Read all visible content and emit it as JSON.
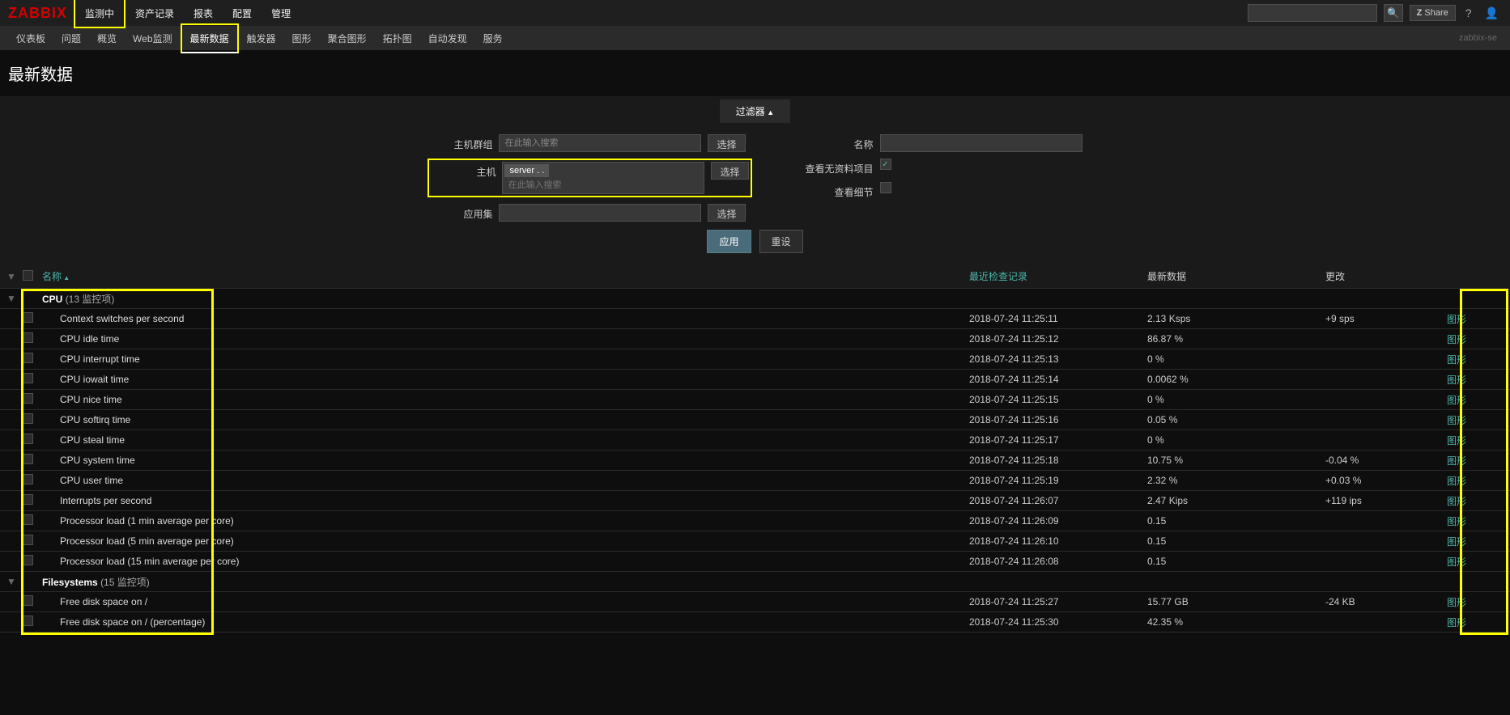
{
  "brand": "ZABBIX",
  "topnav": [
    "监测中",
    "资产记录",
    "报表",
    "配置",
    "管理"
  ],
  "share_label": "Share",
  "subnav": [
    "仪表板",
    "问题",
    "概览",
    "Web监测",
    "最新数据",
    "触发器",
    "图形",
    "聚合图形",
    "拓扑图",
    "自动发现",
    "服务"
  ],
  "server_label": "zabbix-se",
  "page_title": "最新数据",
  "filter": {
    "tab_label": "过滤器",
    "hostgroup_label": "主机群组",
    "hostgroup_placeholder": "在此输入搜索",
    "host_label": "主机",
    "host_tag": "server .                       .",
    "host_placeholder": "在此输入搜索",
    "appset_label": "应用集",
    "select_label": "选择",
    "name_label": "名称",
    "noinventory_label": "查看无资料项目",
    "detail_label": "查看细节",
    "apply_label": "应用",
    "reset_label": "重设"
  },
  "headers": {
    "name": "名称",
    "lastcheck": "最近检查记录",
    "lastdata": "最新数据",
    "change": "更改"
  },
  "groups": [
    {
      "name": "CPU",
      "count": "(13 监控项)",
      "expanded": true,
      "items": [
        {
          "name": "Context switches per second",
          "lastcheck": "2018-07-24 11:25:11",
          "lastdata": "2.13 Ksps",
          "change": "+9 sps",
          "action": "图形"
        },
        {
          "name": "CPU idle time",
          "lastcheck": "2018-07-24 11:25:12",
          "lastdata": "86.87 %",
          "change": "",
          "action": "图形"
        },
        {
          "name": "CPU interrupt time",
          "lastcheck": "2018-07-24 11:25:13",
          "lastdata": "0 %",
          "change": "",
          "action": "图形"
        },
        {
          "name": "CPU iowait time",
          "lastcheck": "2018-07-24 11:25:14",
          "lastdata": "0.0062 %",
          "change": "",
          "action": "图形"
        },
        {
          "name": "CPU nice time",
          "lastcheck": "2018-07-24 11:25:15",
          "lastdata": "0 %",
          "change": "",
          "action": "图形"
        },
        {
          "name": "CPU softirq time",
          "lastcheck": "2018-07-24 11:25:16",
          "lastdata": "0.05 %",
          "change": "",
          "action": "图形"
        },
        {
          "name": "CPU steal time",
          "lastcheck": "2018-07-24 11:25:17",
          "lastdata": "0 %",
          "change": "",
          "action": "图形"
        },
        {
          "name": "CPU system time",
          "lastcheck": "2018-07-24 11:25:18",
          "lastdata": "10.75 %",
          "change": "-0.04 %",
          "action": "图形"
        },
        {
          "name": "CPU user time",
          "lastcheck": "2018-07-24 11:25:19",
          "lastdata": "2.32 %",
          "change": "+0.03 %",
          "action": "图形"
        },
        {
          "name": "Interrupts per second",
          "lastcheck": "2018-07-24 11:26:07",
          "lastdata": "2.47 Kips",
          "change": "+119 ips",
          "action": "图形"
        },
        {
          "name": "Processor load (1 min average per core)",
          "lastcheck": "2018-07-24 11:26:09",
          "lastdata": "0.15",
          "change": "",
          "action": "图形"
        },
        {
          "name": "Processor load (5 min average per core)",
          "lastcheck": "2018-07-24 11:26:10",
          "lastdata": "0.15",
          "change": "",
          "action": "图形"
        },
        {
          "name": "Processor load (15 min average per core)",
          "lastcheck": "2018-07-24 11:26:08",
          "lastdata": "0.15",
          "change": "",
          "action": "图形"
        }
      ]
    },
    {
      "name": "Filesystems",
      "count": "(15 监控项)",
      "expanded": true,
      "items": [
        {
          "name": "Free disk space on /",
          "lastcheck": "2018-07-24 11:25:27",
          "lastdata": "15.77 GB",
          "change": "-24 KB",
          "action": "图形"
        },
        {
          "name": "Free disk space on / (percentage)",
          "lastcheck": "2018-07-24 11:25:30",
          "lastdata": "42.35 %",
          "change": "",
          "action": "图形"
        }
      ]
    }
  ]
}
